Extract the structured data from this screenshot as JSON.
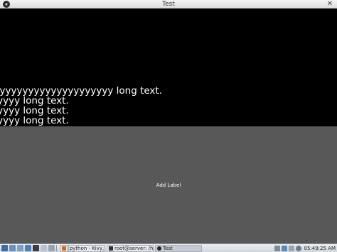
{
  "window": {
    "title": "Test",
    "close_glyph": "✕"
  },
  "content": {
    "lines": [
      "A veryyyyyyyyyyyyyyyyyyyy long text.",
      "yyyyyyyy long text.",
      "yyyyyyyy long text.",
      "yyyyyyyy long text."
    ],
    "button_label": "Add Label"
  },
  "taskbar": {
    "tasks": [
      {
        "label": "[python - Kivy, I...",
        "icon": "browser-icon"
      },
      {
        "label": "root@server: /h...",
        "icon": "terminal-icon"
      },
      {
        "label": "Test",
        "icon": "kivy-app-icon"
      }
    ],
    "clock": "05:49:25 AM"
  },
  "colors": {
    "content_bg": "#000000",
    "button_bg": "#585858",
    "text": "#ffffff"
  }
}
